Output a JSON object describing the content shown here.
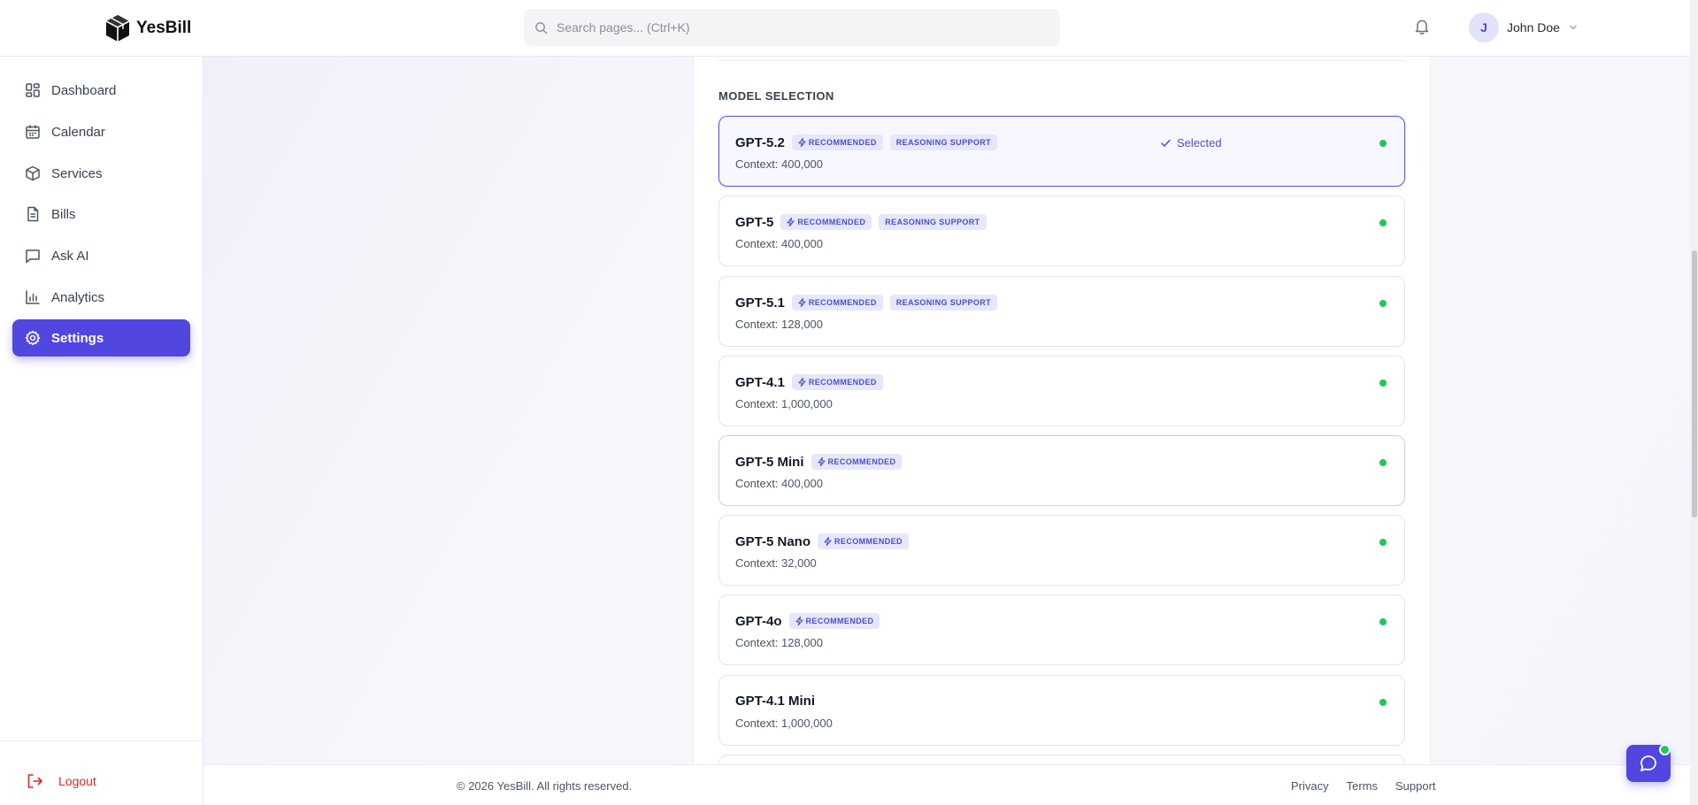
{
  "app": {
    "name": "YesBill"
  },
  "header": {
    "search_placeholder": "Search pages... (Ctrl+K)",
    "user": {
      "initial": "J",
      "name": "John Doe"
    }
  },
  "sidebar": {
    "items": [
      {
        "label": "Dashboard",
        "icon": "dashboard-icon",
        "active": false
      },
      {
        "label": "Calendar",
        "icon": "calendar-icon",
        "active": false
      },
      {
        "label": "Services",
        "icon": "box-icon",
        "active": false
      },
      {
        "label": "Bills",
        "icon": "file-icon",
        "active": false
      },
      {
        "label": "Ask AI",
        "icon": "chat-icon",
        "active": false
      },
      {
        "label": "Analytics",
        "icon": "bar-chart-icon",
        "active": false
      },
      {
        "label": "Settings",
        "icon": "gear-icon",
        "active": true
      }
    ],
    "logout_label": "Logout"
  },
  "main": {
    "section_title": "MODEL SELECTION",
    "selected_label": "Selected",
    "models": [
      {
        "name": "GPT-5.2",
        "badges": [
          "RECOMMENDED",
          "REASONING SUPPORT"
        ],
        "context": "Context: 400,000",
        "selected": true
      },
      {
        "name": "GPT-5",
        "badges": [
          "RECOMMENDED",
          "REASONING SUPPORT"
        ],
        "context": "Context: 400,000",
        "selected": false
      },
      {
        "name": "GPT-5.1",
        "badges": [
          "RECOMMENDED",
          "REASONING SUPPORT"
        ],
        "context": "Context: 128,000",
        "selected": false
      },
      {
        "name": "GPT-4.1",
        "badges": [
          "RECOMMENDED"
        ],
        "context": "Context: 1,000,000",
        "selected": false
      },
      {
        "name": "GPT-5 Mini",
        "badges": [
          "RECOMMENDED"
        ],
        "context": "Context: 400,000",
        "selected": false
      },
      {
        "name": "GPT-5 Nano",
        "badges": [
          "RECOMMENDED"
        ],
        "context": "Context: 32,000",
        "selected": false
      },
      {
        "name": "GPT-4o",
        "badges": [
          "RECOMMENDED"
        ],
        "context": "Context: 128,000",
        "selected": false
      },
      {
        "name": "GPT-4.1 Mini",
        "badges": [],
        "context": "Context: 1,000,000",
        "selected": false
      }
    ]
  },
  "footer": {
    "copyright": "© 2026 YesBill. All rights reserved.",
    "links": [
      "Privacy",
      "Terms",
      "Support"
    ]
  },
  "colors": {
    "accent": "#5146e0",
    "status_ok": "#22c55e",
    "logout": "#dc2626"
  }
}
